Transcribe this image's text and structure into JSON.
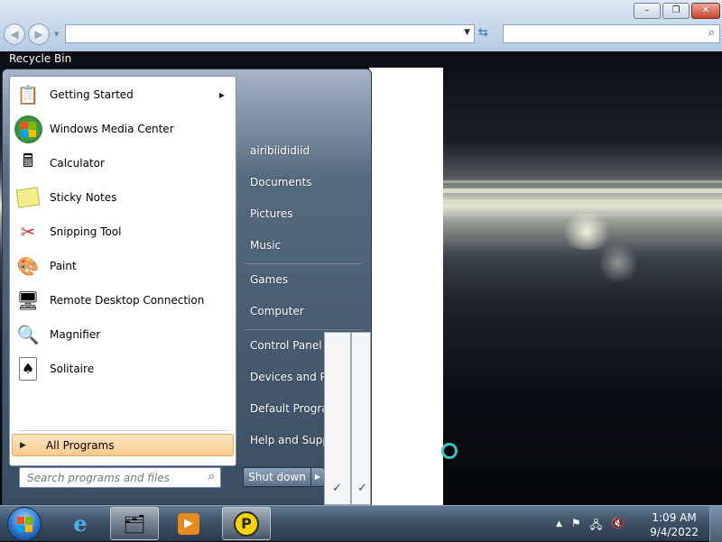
{
  "browser": {
    "back_symbol": "◀",
    "forward_symbol": "▶",
    "address_value": "",
    "search_value": "",
    "window_buttons": {
      "minimize": "–",
      "maximize": "❐",
      "close": "✕"
    }
  },
  "desktop": {
    "recycle_bin_label": "Recycle Bin"
  },
  "start_menu": {
    "programs": [
      {
        "label": "Getting Started",
        "icon": "getting-started-icon",
        "glyph": "📋",
        "has_submenu": true
      },
      {
        "label": "Windows Media Center",
        "icon": "media-center-icon",
        "glyph": "⊞",
        "has_submenu": false
      },
      {
        "label": "Calculator",
        "icon": "calculator-icon",
        "glyph": "🖩",
        "has_submenu": false
      },
      {
        "label": "Sticky Notes",
        "icon": "sticky-notes-icon",
        "glyph": "🗒",
        "has_submenu": false
      },
      {
        "label": "Snipping Tool",
        "icon": "scissors-icon",
        "glyph": "✂",
        "has_submenu": false
      },
      {
        "label": "Paint",
        "icon": "paint-palette-icon",
        "glyph": "🎨",
        "has_submenu": false
      },
      {
        "label": "Remote Desktop Connection",
        "icon": "remote-desktop-icon",
        "glyph": "🖥",
        "has_submenu": false
      },
      {
        "label": "Magnifier",
        "icon": "magnifier-icon",
        "glyph": "🔍",
        "has_submenu": false
      },
      {
        "label": "Solitaire",
        "icon": "solitaire-icon",
        "glyph": "♠",
        "has_submenu": false
      }
    ],
    "all_programs_label": "All Programs",
    "search_placeholder": "Search programs and files",
    "right_items": [
      {
        "label": "airibiididiid"
      },
      {
        "label": "Documents"
      },
      {
        "label": "Pictures"
      },
      {
        "label": "Music"
      },
      {
        "label": "Games"
      },
      {
        "label": "Computer"
      },
      {
        "label": "Control Panel"
      },
      {
        "label": "Devices and Printers"
      },
      {
        "label": "Default Programs"
      },
      {
        "label": "Help and Support"
      }
    ],
    "shutdown_label": "Shut down"
  },
  "popups": {
    "check_symbol": "✓"
  },
  "taskbar": {
    "pinned": [
      {
        "name": "internet-explorer-icon",
        "glyph": "e",
        "active": false
      },
      {
        "name": "windows-explorer-icon",
        "glyph": "🗂",
        "active": true
      },
      {
        "name": "media-player-icon",
        "glyph": "▶",
        "active": false
      },
      {
        "name": "app-p-icon",
        "glyph": "P",
        "active": true
      }
    ],
    "tray": {
      "show_hidden_symbol": "▲",
      "flag_symbol": "⚑",
      "network_symbol": "🖧",
      "volume_symbol": "🔇"
    },
    "clock": {
      "time": "1:09 AM",
      "date": "9/4/2022"
    }
  },
  "colors": {
    "all_programs_bg": "#f9cb8e",
    "cursor_ring": "#34c6c0",
    "start_orb": "#2b74c9"
  }
}
